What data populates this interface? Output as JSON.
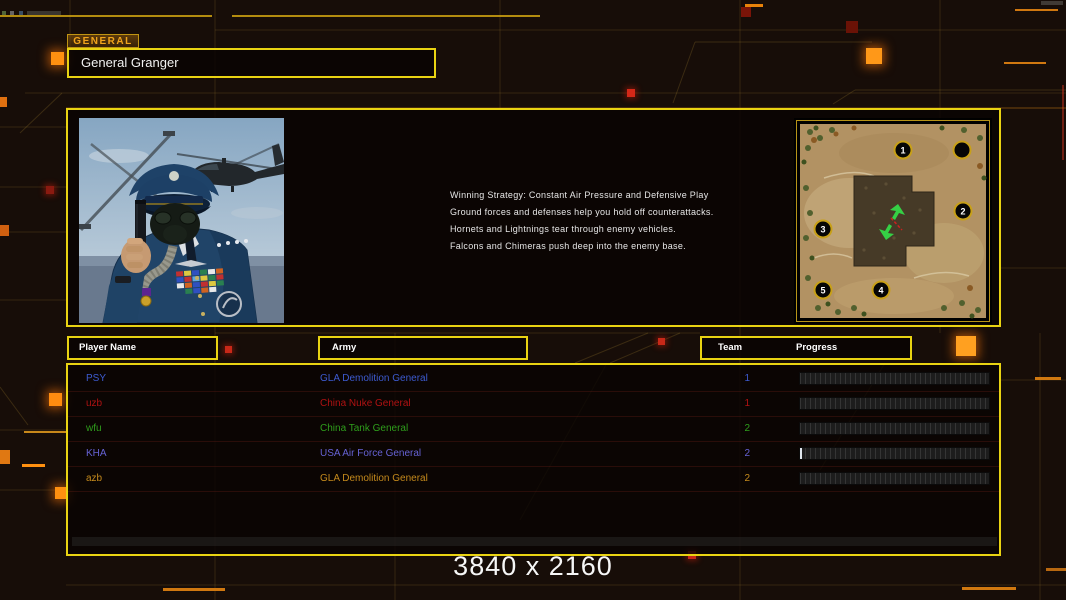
{
  "header": {
    "tag_label": "GENERAL",
    "general_name": "General Granger"
  },
  "info_panel": {
    "strategy_lines": [
      "Winning Strategy: Constant Air Pressure and Defensive Play",
      "Ground forces and defenses help you hold off counterattacks.",
      "Hornets and Lightnings tear through enemy vehicles.",
      "Falcons and Chimeras push deep into the enemy base."
    ],
    "map_markers": [
      "1",
      "2",
      "3",
      "4",
      "5"
    ]
  },
  "players_table": {
    "headers": {
      "player": "Player Name",
      "army": "Army",
      "team": "Team",
      "progress": "Progress"
    },
    "rows": [
      {
        "name": "PSY",
        "army": "GLA Demolition General",
        "team": "1",
        "color": "#3d5bd0",
        "progress_percent": 0
      },
      {
        "name": "uzb",
        "army": "China Nuke General",
        "team": "1",
        "color": "#b01212",
        "progress_percent": 0
      },
      {
        "name": "wfu",
        "army": "China Tank General",
        "team": "2",
        "color": "#2f9e1c",
        "progress_percent": 0
      },
      {
        "name": "KHA",
        "army": "USA Air Force General",
        "team": "2",
        "color": "#6662d4",
        "progress_percent": 1
      },
      {
        "name": "azb",
        "army": "GLA Demolition General",
        "team": "2",
        "color": "#c58a1c",
        "progress_percent": 0
      }
    ]
  },
  "footer": {
    "resolution_label": "3840 x 2160"
  },
  "colors": {
    "accent_yellow": "#e9d312",
    "accent_orange": "#ff8c10",
    "background": "#170d08"
  }
}
